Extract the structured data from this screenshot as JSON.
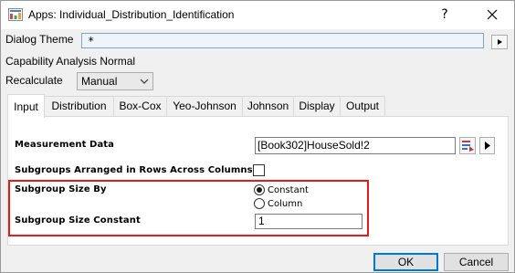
{
  "window": {
    "title": "Apps: Individual_Distribution_Identification",
    "help_label": "?"
  },
  "dialog_theme": {
    "label": "Dialog Theme",
    "value": "*"
  },
  "capability_text": "Capability Analysis Normal",
  "recalculate": {
    "label": "Recalculate",
    "selected": "Manual"
  },
  "tabs": [
    {
      "label": "Input",
      "active": true
    },
    {
      "label": "Distribution",
      "active": false
    },
    {
      "label": "Box-Cox",
      "active": false
    },
    {
      "label": "Yeo-Johnson",
      "active": false
    },
    {
      "label": "Johnson",
      "active": false
    },
    {
      "label": "Display",
      "active": false
    },
    {
      "label": "Output",
      "active": false
    }
  ],
  "input_panel": {
    "measurement_label": "Measurement Data",
    "measurement_value": "[Book302]HouseSold!2",
    "subgroups_rows_label": "Subgroups Arranged in Rows Across Columns",
    "subgroup_size_by_label": "Subgroup Size By",
    "radio_constant": "Constant",
    "radio_column": "Column",
    "subgroup_size_constant_label": "Subgroup Size Constant",
    "subgroup_size_constant_value": "1"
  },
  "buttons": {
    "ok": "OK",
    "cancel": "Cancel"
  },
  "colors": {
    "highlight": "#e41b1b",
    "accent": "#0078d7"
  }
}
